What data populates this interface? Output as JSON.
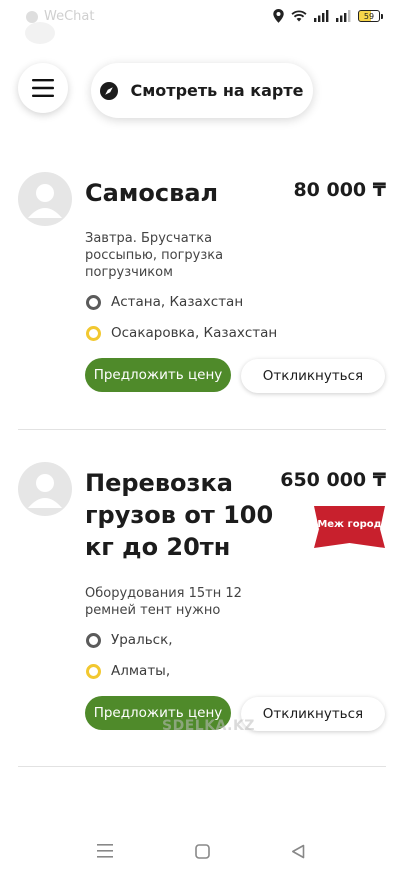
{
  "status_bar": {
    "app_label": "WeChat",
    "battery": "59",
    "icons": [
      "location-icon",
      "wifi-icon",
      "signal-icon",
      "signal-icon",
      "battery-icon"
    ]
  },
  "top": {
    "menu_icon": "hamburger-icon",
    "map_button_label": "Смотреть на карте",
    "map_icon": "compass-icon"
  },
  "listings": [
    {
      "title": "Самосвал",
      "price": "80 000 ₸",
      "description": "Завтра. Брусчатка россыпью, погрузка погрузчиком",
      "origin": "Астана, Казахстан",
      "destination": "Осакаровка, Казахстан",
      "offer_label": "Предложить цену",
      "respond_label": "Откликнуться"
    },
    {
      "title": "Перевозка грузов от 100 кг до 20тн",
      "price": "650 000 ₸",
      "badge": "Меж город",
      "description": "Оборудования 15тн 12 ремней тент нужно",
      "origin": "Уральск,",
      "destination": "Алматы,",
      "offer_label": "Предложить цену",
      "respond_label": "Откликнуться"
    }
  ],
  "watermark": "SDELKA.KZ",
  "colors": {
    "primary_green": "#4f8a2a",
    "badge_red": "#c8202d",
    "destination_yellow": "#f2c830",
    "origin_gray": "#5b5b5b"
  },
  "nav_bar": {
    "icons": [
      "menu-lines-icon",
      "home-square-icon",
      "back-triangle-icon"
    ]
  }
}
